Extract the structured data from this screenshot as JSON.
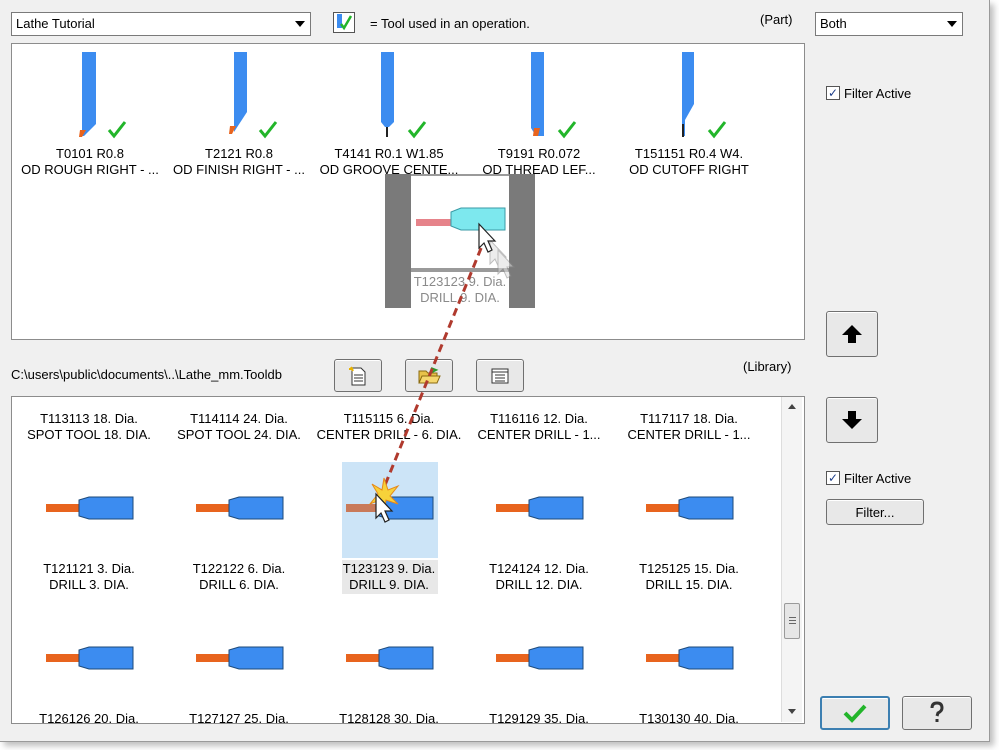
{
  "header": {
    "tooldb_value": "Lathe Tutorial",
    "legend_text": "= Tool used in an operation.",
    "part_label": "(Part)",
    "both_value": "Both",
    "library_label": "(Library)",
    "path_text": "C:\\users\\public\\documents\\..\\Lathe_mm.Tooldb"
  },
  "part_tools": [
    {
      "line1": "T0101 R0.8",
      "line2": "OD ROUGH RIGHT - ..."
    },
    {
      "line1": "T2121 R0.8",
      "line2": "OD FINISH RIGHT - ..."
    },
    {
      "line1": "T4141 R0.1 W1.85",
      "line2": "OD GROOVE CENTE..."
    },
    {
      "line1": "T9191 R0.072",
      "line2": "OD THREAD LEF..."
    },
    {
      "line1": "T151151 R0.4 W4.",
      "line2": "OD CUTOFF RIGHT"
    }
  ],
  "drag_ghost": {
    "line1": "T123123 9. Dia.",
    "line2": "DRILL 9. DIA."
  },
  "library_tools": [
    {
      "line1": "T113113 18. Dia.",
      "line2": "SPOT TOOL 18. DIA."
    },
    {
      "line1": "T114114 24. Dia.",
      "line2": "SPOT TOOL  24. DIA."
    },
    {
      "line1": "T115115 6. Dia.",
      "line2": "CENTER DRILL - 6. DIA."
    },
    {
      "line1": "T116116 12. Dia.",
      "line2": "CENTER DRILL - 1..."
    },
    {
      "line1": "T117117 18. Dia.",
      "line2": "CENTER DRILL - 1..."
    },
    {
      "line1": "T121121 3. Dia.",
      "line2": "DRILL 3. DIA."
    },
    {
      "line1": "T122122 6. Dia.",
      "line2": "DRILL 6. DIA."
    },
    {
      "line1": "T123123 9. Dia.",
      "line2": "DRILL 9. DIA."
    },
    {
      "line1": "T124124 12. Dia.",
      "line2": "DRILL 12. DIA."
    },
    {
      "line1": "T125125 15. Dia.",
      "line2": "DRILL 15. DIA."
    },
    {
      "line1": "T126126 20. Dia.",
      "line2": ""
    },
    {
      "line1": "T127127 25. Dia.",
      "line2": ""
    },
    {
      "line1": "T128128 30. Dia.",
      "line2": ""
    },
    {
      "line1": "T129129 35. Dia.",
      "line2": ""
    },
    {
      "line1": "T130130 40. Dia.",
      "line2": ""
    }
  ],
  "filters": {
    "part_filter_label": "Filter Active",
    "part_filter_checked": true,
    "library_filter_label": "Filter Active",
    "library_filter_checked": true,
    "filter_button_label": "Filter..."
  },
  "colors": {
    "tool_blue": "#3c8cf0",
    "insert_orange": "#e8641e",
    "check_green": "#22b52a",
    "selection": "#cce4f7",
    "drag_line": "#b03a2e"
  },
  "icons": {
    "move_up": "up-arrow-icon",
    "move_down": "down-arrow-icon",
    "ok": "checkmark-icon",
    "help": "question-mark-icon"
  }
}
